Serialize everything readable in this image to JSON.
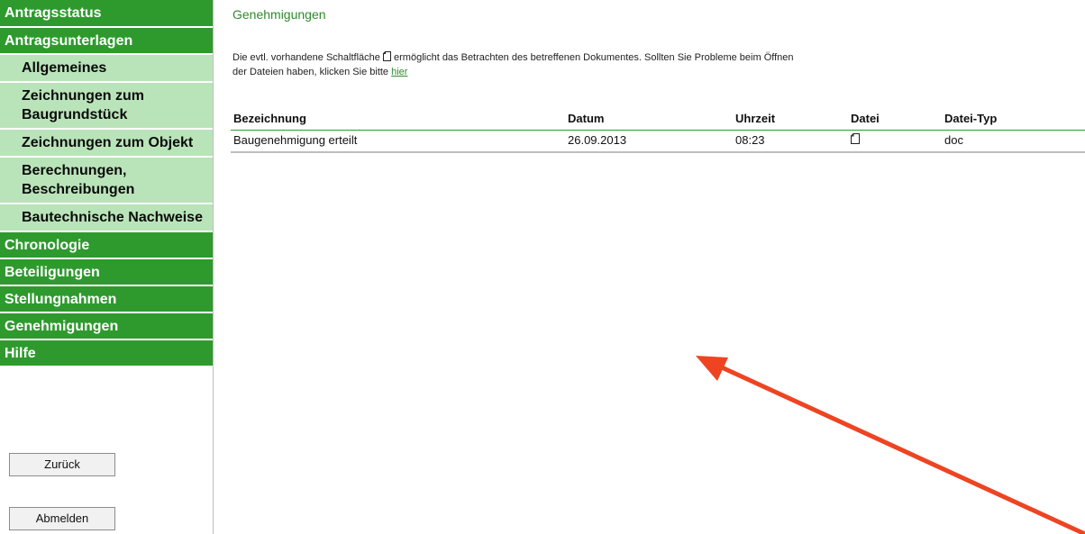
{
  "sidebar": {
    "top_items": [
      {
        "label": "Antragsstatus"
      },
      {
        "label": "Antragsunterlagen"
      }
    ],
    "sub_items": [
      {
        "label": "Allgemeines"
      },
      {
        "label": "Zeichnungen zum Baugrundstück"
      },
      {
        "label": "Zeichnungen zum Objekt"
      },
      {
        "label": "Berechnungen, Beschreibungen"
      },
      {
        "label": "Bautechnische Nachweise"
      }
    ],
    "bottom_items": [
      {
        "label": "Chronologie"
      },
      {
        "label": "Beteiligungen"
      },
      {
        "label": "Stellungnahmen"
      },
      {
        "label": "Genehmigungen"
      },
      {
        "label": "Hilfe"
      }
    ],
    "back_button": "Zurück",
    "logout_button": "Abmelden"
  },
  "main": {
    "title": "Genehmigungen",
    "intro_part1": "Die evtl. vorhandene Schaltfläche",
    "intro_part2": "ermöglicht das Betrachten des betreffenen Dokumentes. Sollten Sie Probleme beim Öffnen",
    "intro_part3": "der Dateien haben, klicken Sie bitte",
    "intro_link": "hier",
    "table": {
      "headers": [
        "Bezeichnung",
        "Datum",
        "Uhrzeit",
        "Datei",
        "Datei-Typ"
      ],
      "rows": [
        {
          "bezeichnung": "Baugenehmigung erteilt",
          "datum": "26.09.2013",
          "uhrzeit": "08:23",
          "datei_icon": "document-icon",
          "typ": "doc"
        }
      ]
    }
  },
  "annotation": {
    "color": "#ee4422"
  }
}
